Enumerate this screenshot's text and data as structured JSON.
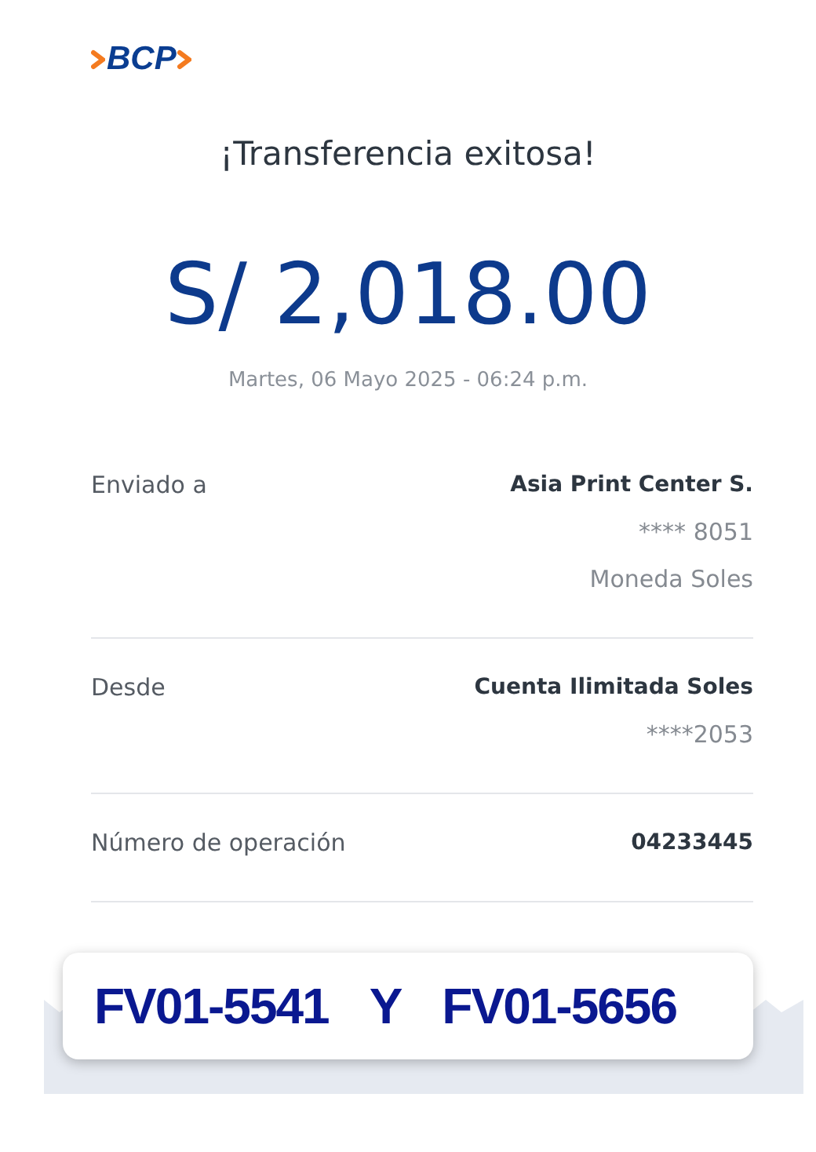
{
  "logo": {
    "text": "BCP"
  },
  "title": "¡Transferencia exitosa!",
  "amount": "S/ 2,018.00",
  "date": "Martes, 06 Mayo 2025 - 06:24 p.m.",
  "details": [
    {
      "label": "Enviado a",
      "values": [
        {
          "text": "Asia Print Center S.",
          "emphasis": true
        },
        {
          "text": "**** 8051",
          "emphasis": false
        },
        {
          "text": "Moneda Soles",
          "emphasis": false
        }
      ]
    },
    {
      "label": "Desde",
      "values": [
        {
          "text": "Cuenta Ilimitada Soles",
          "emphasis": true
        },
        {
          "text": "****2053",
          "emphasis": false
        }
      ]
    },
    {
      "label": "Número de operación",
      "values": [
        {
          "text": "04233445",
          "emphasis": true
        }
      ]
    }
  ],
  "note": {
    "parts": [
      "FV01-5541",
      "Y",
      "FV01-5656"
    ]
  }
}
